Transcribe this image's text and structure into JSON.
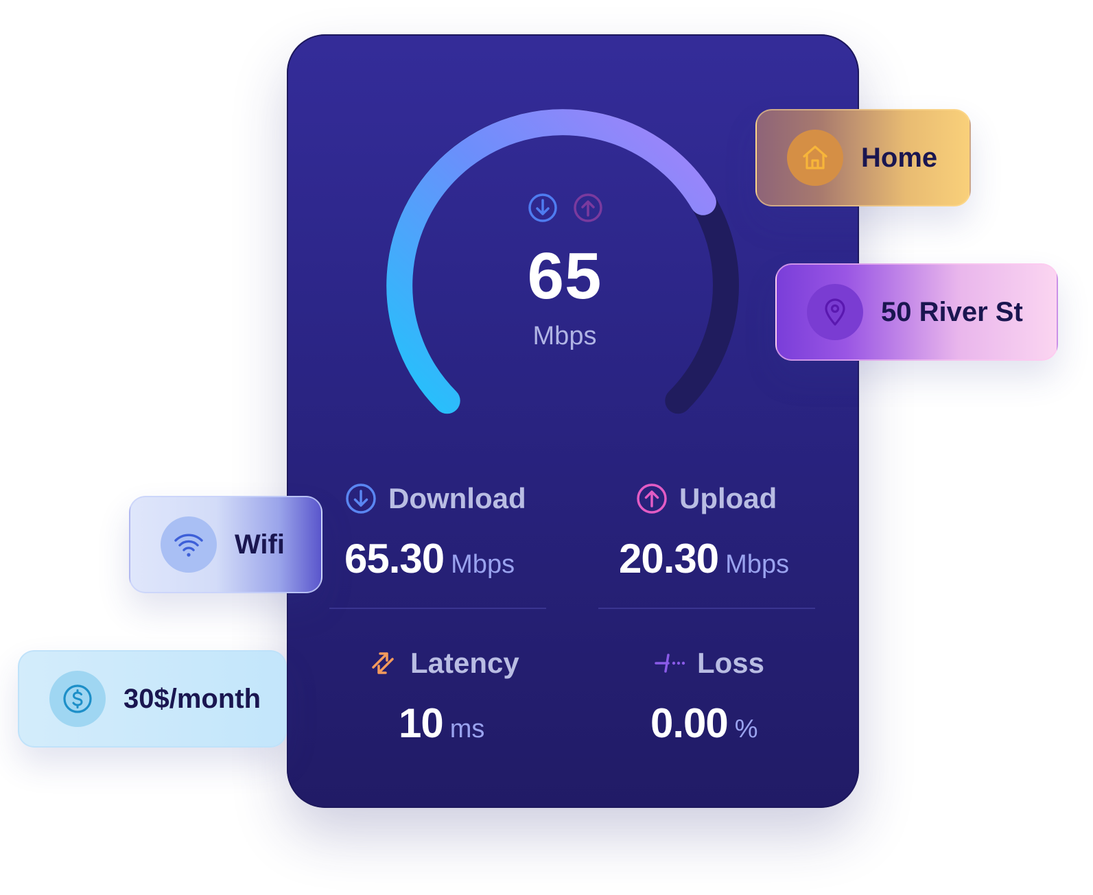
{
  "speed_test": {
    "value": "65",
    "unit": "Mbps",
    "gauge_fraction": 0.72,
    "colors": {
      "gauge_start": "#22c3fb",
      "gauge_mid": "#6b8ffb",
      "gauge_end": "#a483fa",
      "track": "#201c5e"
    }
  },
  "stats": {
    "download": {
      "label": "Download",
      "value": "65.30",
      "unit": "Mbps",
      "icon": "arrow-down-circle-icon",
      "color": "#5a86f2"
    },
    "upload": {
      "label": "Upload",
      "value": "20.30",
      "unit": "Mbps",
      "icon": "arrow-up-circle-icon",
      "color": "#e25cc4"
    },
    "latency": {
      "label": "Latency",
      "value": "10",
      "unit": "ms",
      "icon": "swap-arrows-icon",
      "color": "#f39a5c"
    },
    "loss": {
      "label": "Loss",
      "value": "0.00",
      "unit": "%",
      "icon": "packet-loss-icon",
      "color": "#8a5be8"
    }
  },
  "tags": {
    "home": {
      "label": "Home",
      "icon": "house-icon"
    },
    "address": {
      "label": "50 River St",
      "icon": "map-pin-icon"
    },
    "connection": {
      "label": "Wifi",
      "icon": "wifi-icon"
    },
    "price": {
      "label": "30$/month",
      "icon": "dollar-coin-icon"
    }
  }
}
